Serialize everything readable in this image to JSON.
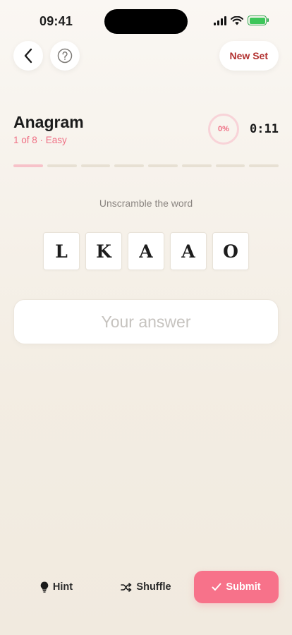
{
  "status_bar": {
    "time": "09:41"
  },
  "nav": {
    "new_set_label": "New Set"
  },
  "game": {
    "title": "Anagram",
    "subtitle": "1 of 8 · Easy",
    "progress_percent": 0,
    "progress_label": "0%",
    "timer": "0:11",
    "total_words": 8,
    "current_index": 1,
    "prompt": "Unscramble the word",
    "letters": [
      "L",
      "K",
      "A",
      "A",
      "O"
    ]
  },
  "answer": {
    "value": "",
    "placeholder": "Your answer"
  },
  "actions": {
    "hint_label": "Hint",
    "shuffle_label": "Shuffle",
    "submit_label": "Submit"
  },
  "colors": {
    "accent": "#f7728a",
    "accent_text": "#ef6f84",
    "new_set_text": "#b2302f",
    "segment_active": "#f7c2c9",
    "segment_inactive": "#e7e0d3"
  }
}
